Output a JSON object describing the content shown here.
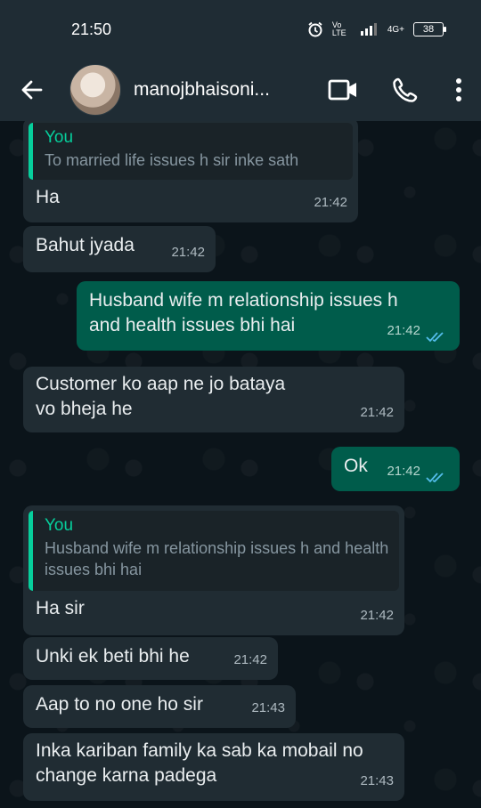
{
  "status_bar": {
    "time": "21:50",
    "network_label": "Vo LTE",
    "signal_label": "4G+",
    "battery": "38"
  },
  "header": {
    "contact_name": "manojbhaisoni...",
    "back_icon": "arrow-left-icon",
    "video_icon": "video-call-icon",
    "call_icon": "phone-icon",
    "more_icon": "more-vertical-icon"
  },
  "messages": [
    {
      "dir": "in",
      "quote_author": "You",
      "quote_text": "To married life issues h sir inke sath",
      "text": "Ha",
      "time": "21:42"
    },
    {
      "dir": "in",
      "text": "Bahut jyada",
      "time": "21:42"
    },
    {
      "dir": "out",
      "text": "Husband wife m relationship issues h and health issues bhi hai",
      "time": "21:42",
      "status": "read"
    },
    {
      "dir": "in",
      "text": "Customer ko aap ne jo bataya vo bheja he",
      "time": "21:42"
    },
    {
      "dir": "out",
      "text": "Ok",
      "time": "21:42",
      "status": "read"
    },
    {
      "dir": "in",
      "quote_author": "You",
      "quote_text": "Husband wife m relationship issues h and health issues bhi hai",
      "text": "Ha sir",
      "time": "21:42"
    },
    {
      "dir": "in",
      "text": "Unki ek beti bhi he",
      "time": "21:42"
    },
    {
      "dir": "in",
      "text": "Aap to no one ho sir",
      "time": "21:43"
    },
    {
      "dir": "in",
      "text": "Inka kariban family ka sab ka mobail no change karna padega",
      "time": "21:43"
    }
  ],
  "colors": {
    "header_bg": "#1f2c34",
    "chat_bg": "#0b141a",
    "incoming_bubble": "#202c33",
    "outgoing_bubble": "#005c4b",
    "quote_accent": "#06cf9c",
    "read_ticks": "#53bdeb"
  }
}
